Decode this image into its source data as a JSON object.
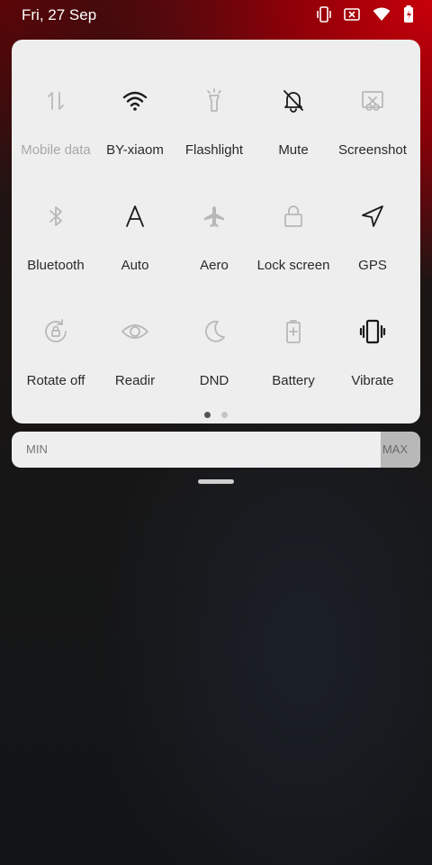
{
  "status_bar": {
    "time": "Fri, 27 Sep",
    "icons": [
      "vibrate-icon",
      "no-sim-icon",
      "wifi-icon",
      "battery-charging-icon"
    ]
  },
  "quick_tiles": [
    {
      "label": "Mobile data",
      "icon": "mobile-data-icon",
      "active": false
    },
    {
      "label": "BY-xiaom",
      "icon": "wifi-icon",
      "active": true
    },
    {
      "label": "Flashlight",
      "icon": "flashlight-icon",
      "active": false
    },
    {
      "label": "Mute",
      "icon": "mute-bell-icon",
      "active": true
    },
    {
      "label": "Screenshot",
      "icon": "screenshot-icon",
      "active": false
    },
    {
      "label": "Bluetooth",
      "icon": "bluetooth-icon",
      "active": false
    },
    {
      "label": "Auto",
      "icon": "auto-brightness-icon",
      "active": true
    },
    {
      "label": "Aero",
      "icon": "airplane-icon",
      "active": false
    },
    {
      "label": "Lock screen",
      "icon": "lock-icon",
      "active": false
    },
    {
      "label": "GPS",
      "icon": "gps-icon",
      "active": true
    },
    {
      "label": "Rotate off",
      "icon": "rotate-lock-icon",
      "active": false
    },
    {
      "label": "Readir",
      "icon": "eye-icon",
      "active": false
    },
    {
      "label": "DND",
      "icon": "moon-icon",
      "active": false
    },
    {
      "label": "Battery",
      "icon": "battery-saver-icon",
      "active": false
    },
    {
      "label": "Vibrate",
      "icon": "vibrate-icon",
      "active": true
    }
  ],
  "pagination": {
    "pages": 2,
    "current": 1
  },
  "brightness": {
    "min_label": "MIN",
    "max_label": "MAX"
  }
}
